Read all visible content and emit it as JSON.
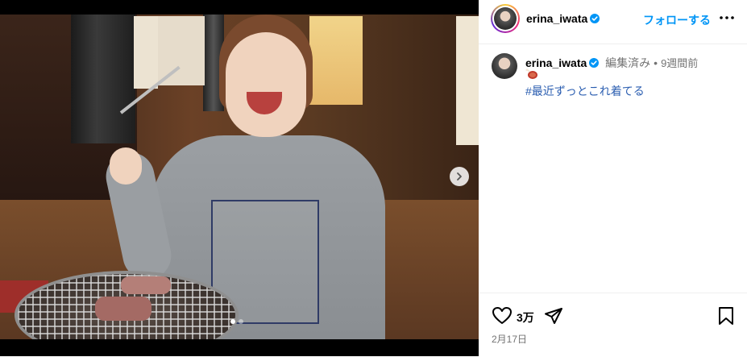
{
  "post": {
    "username": "erina_iwata",
    "follow_label": "フォローする",
    "caption": {
      "username": "erina_iwata",
      "edited_label": "編集済み",
      "separator": "•",
      "time_ago": "9週間前",
      "emoji_icon": "meat-on-bone-icon",
      "hashtag": "#最近ずっとこれ着てる"
    },
    "likes": "3万",
    "date": "2月17日"
  },
  "carousel": {
    "current": 1,
    "total": 2
  },
  "colors": {
    "accent": "#0095f6",
    "hashtag": "#2a5db0",
    "muted": "#737373"
  }
}
